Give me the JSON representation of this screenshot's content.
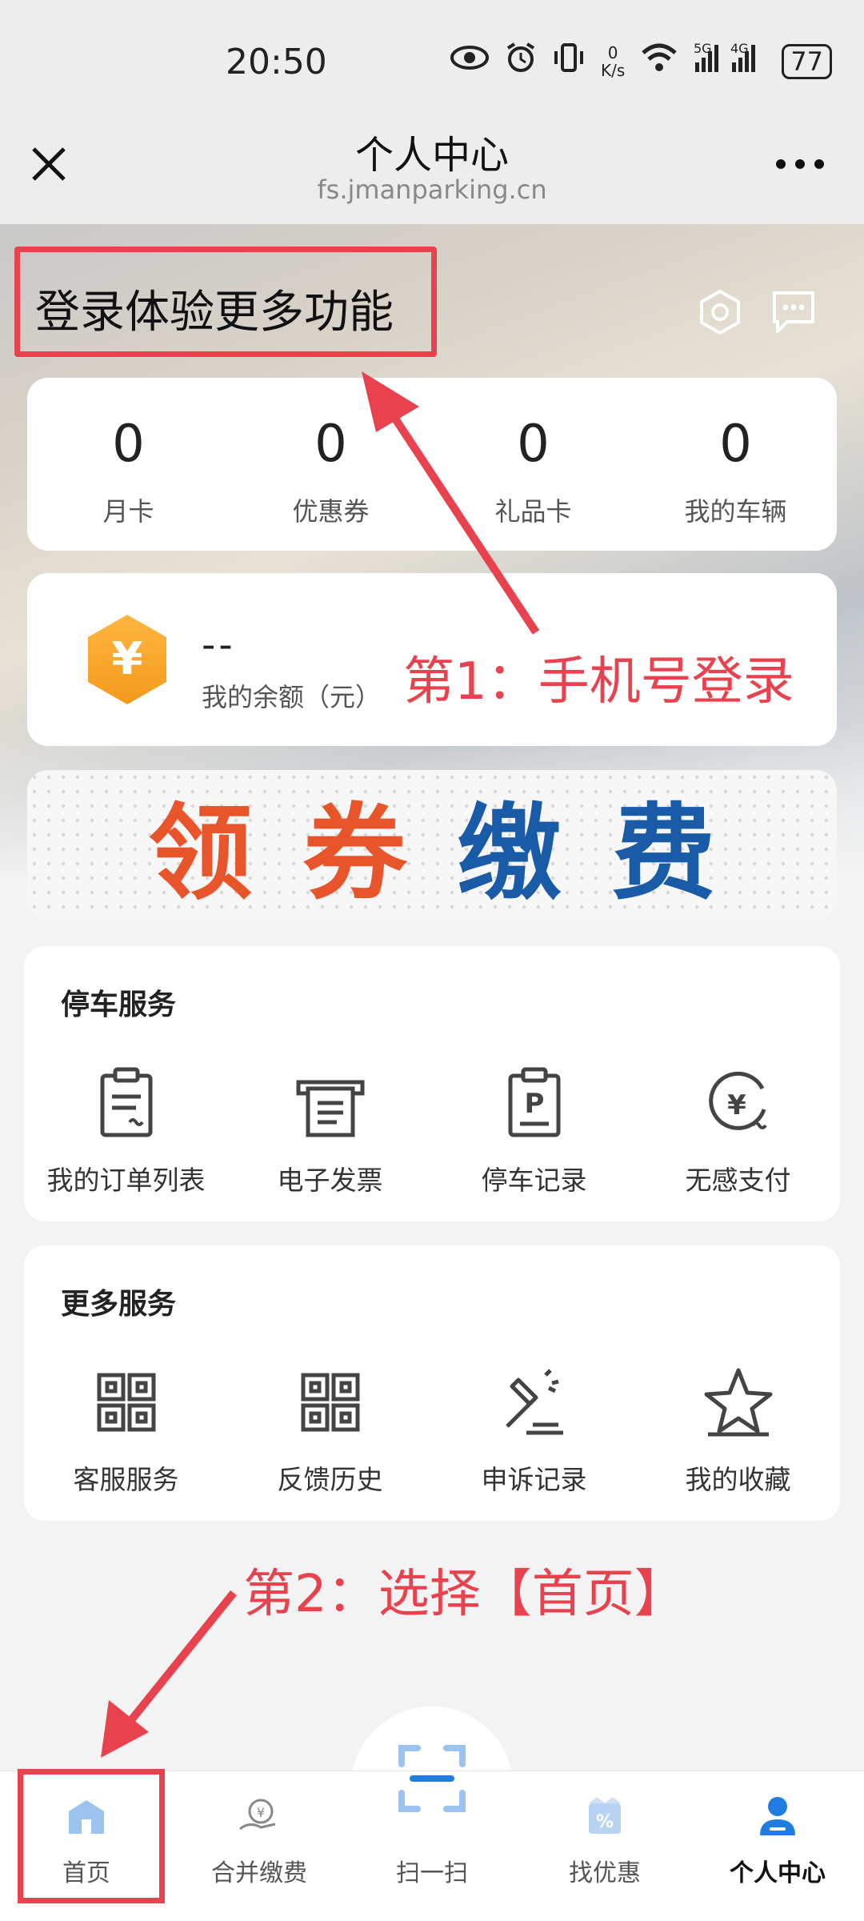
{
  "status_bar": {
    "time": "20:50",
    "net_speed_top": "0",
    "net_speed_bottom": "K/s",
    "sig1": "5G",
    "sig2": "4G",
    "battery": "77",
    "icons": [
      "eye-icon",
      "alarm-icon",
      "vibrate-icon",
      "wifi-icon",
      "signal-icon",
      "battery-icon"
    ]
  },
  "header": {
    "title": "个人中心",
    "subtitle": "fs.jmanparking.cn"
  },
  "hero": {
    "login_text": "登录体验更多功能"
  },
  "stats": [
    {
      "value": "0",
      "label": "月卡"
    },
    {
      "value": "0",
      "label": "优惠券"
    },
    {
      "value": "0",
      "label": "礼品卡"
    },
    {
      "value": "0",
      "label": "我的车辆"
    }
  ],
  "balance": {
    "value": "--",
    "label": "我的余额（元）",
    "icon_symbol": "¥"
  },
  "banner": {
    "chars": [
      "领",
      "券",
      "缴",
      "费"
    ],
    "colors": [
      "#e8552a",
      "#e8552a",
      "#1a5ba8",
      "#1a5ba8"
    ]
  },
  "parking_services": {
    "title": "停车服务",
    "items": [
      {
        "label": "我的订单列表",
        "icon": "order-list-icon"
      },
      {
        "label": "电子发票",
        "icon": "invoice-icon"
      },
      {
        "label": "停车记录",
        "icon": "parking-record-icon"
      },
      {
        "label": "无感支付",
        "icon": "auto-pay-icon"
      }
    ]
  },
  "more_services": {
    "title": "更多服务",
    "items": [
      {
        "label": "客服服务",
        "icon": "customer-service-icon"
      },
      {
        "label": "反馈历史",
        "icon": "feedback-history-icon"
      },
      {
        "label": "申诉记录",
        "icon": "appeal-record-icon"
      },
      {
        "label": "我的收藏",
        "icon": "favorites-icon"
      }
    ]
  },
  "annotations": {
    "step1": "第1：手机号登录",
    "step2": "第2：选择【首页】",
    "color": "#e8424f"
  },
  "bottom_nav": [
    {
      "label": "首页",
      "icon": "home-icon"
    },
    {
      "label": "合并缴费",
      "icon": "merge-pay-icon"
    },
    {
      "label": "扫一扫",
      "icon": "scan-icon"
    },
    {
      "label": "找优惠",
      "icon": "discount-icon"
    },
    {
      "label": "个人中心",
      "icon": "profile-icon",
      "active": true
    }
  ]
}
